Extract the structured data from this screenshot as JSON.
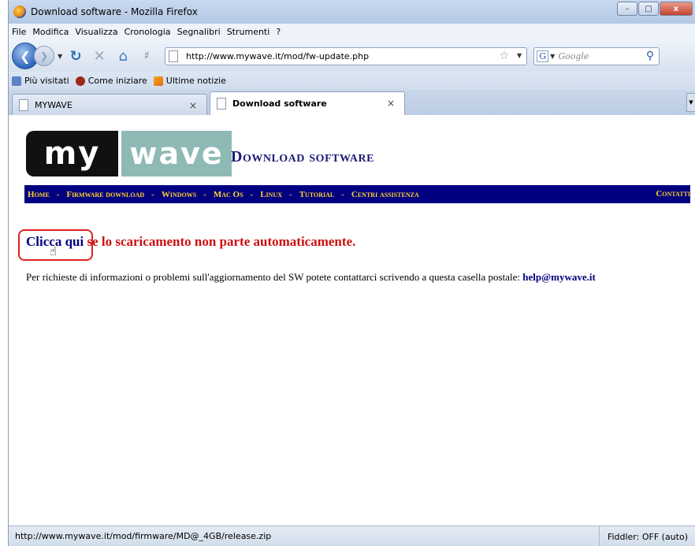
{
  "window": {
    "title": "Download software - Mozilla Firefox",
    "controls": {
      "minimize": "–",
      "maximize": "□",
      "close": "x"
    }
  },
  "menu": [
    "File",
    "Modifica",
    "Visualizza",
    "Cronologia",
    "Segnalibri",
    "Strumenti",
    "?"
  ],
  "nav": {
    "url": "http://www.mywave.it/mod/fw-update.php",
    "search_placeholder": "Google",
    "search_engine_glyph": "G"
  },
  "bookmarks": [
    "Più visitati",
    "Come iniziare",
    "Ultime notizie"
  ],
  "tabs": [
    {
      "label": "MYWAVE",
      "active": false
    },
    {
      "label": "Download software",
      "active": true
    }
  ],
  "page": {
    "logo_left": "my",
    "logo_right": "wave",
    "title": "Download software",
    "site_nav": [
      "Home",
      "Firmware download",
      "Windows",
      "Mac Os",
      "Linux",
      "Tutorial",
      "Centri assistenza"
    ],
    "site_nav_right": "Contatti",
    "click_link": "Clicca qui",
    "click_rest": " se lo scaricamento non parte automaticamente.",
    "info_text": "Per richieste di informazioni o problemi sull'aggiornamento del SW potete contattarci scrivendo a questa casella postale: ",
    "info_email": "help@mywave.it"
  },
  "status": {
    "url": "http://www.mywave.it/mod/firmware/MD@_4GB/release.zip",
    "fiddler": "Fiddler: OFF (auto)"
  },
  "colors": {
    "site_nav_bg": "#000080",
    "site_nav_text": "#ffd233",
    "link": "#000080",
    "alert_text": "#cc1010",
    "logo_wave_bg": "#8fb9b4"
  }
}
